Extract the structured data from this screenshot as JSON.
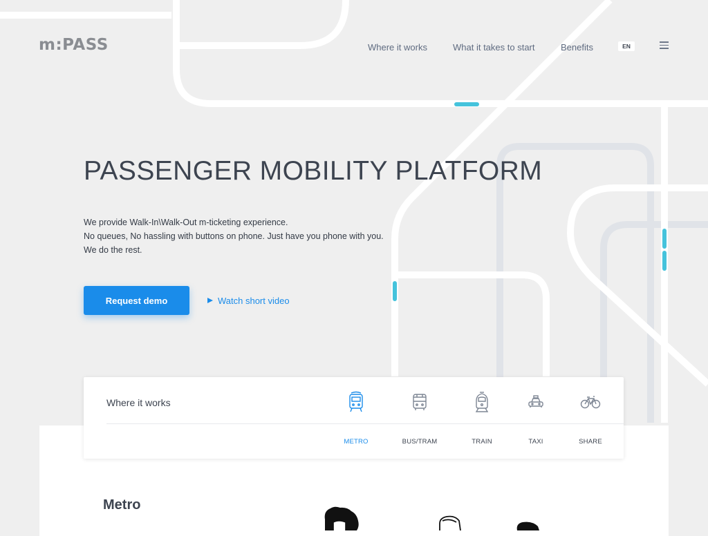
{
  "header": {
    "logo": "m:PASS",
    "nav": [
      {
        "label": "Where it works"
      },
      {
        "label": "What it takes to start"
      },
      {
        "label": "Benefits"
      }
    ],
    "language": "EN",
    "menu_icon": "hamburger-menu-icon"
  },
  "hero": {
    "title": "PASSENGER MOBILITY PLATFORM",
    "description": [
      "We provide Walk-In\\Walk-Out m-ticketing experience.",
      "No queues, No hassling with buttons on phone. Just have you phone with you.",
      "We do the rest."
    ],
    "cta_label": "Request demo",
    "video_label": "Watch short video",
    "video_icon": "play-icon"
  },
  "where_it_works": {
    "title": "Where it works",
    "modes": [
      {
        "label": "METRO",
        "icon": "metro-icon",
        "active": true
      },
      {
        "label": "BUS/TRAM",
        "icon": "bus-icon",
        "active": false
      },
      {
        "label": "TRAIN",
        "icon": "train-icon",
        "active": false
      },
      {
        "label": "TAXI",
        "icon": "taxi-icon",
        "active": false
      },
      {
        "label": "SHARE",
        "icon": "bicycle-icon",
        "active": false
      }
    ]
  },
  "section": {
    "title": "Metro"
  },
  "colors": {
    "accent": "#1a8cea",
    "background": "#efefef",
    "line_highlight": "#45c3dc",
    "text": "#3d4450"
  }
}
